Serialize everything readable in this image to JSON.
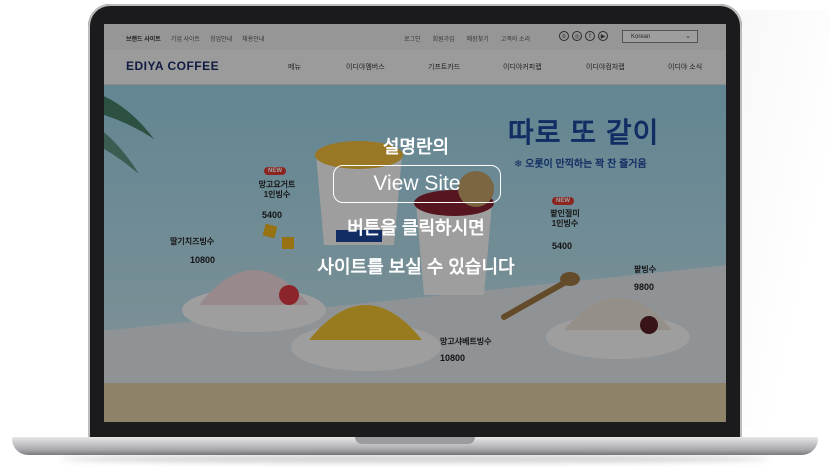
{
  "site": {
    "util_links": [
      "브랜드 사이트",
      "기업 사이트",
      "창업안내",
      "채용안내"
    ],
    "util_right": [
      "로그인",
      "회원가입",
      "매장찾기",
      "고객의 소리"
    ],
    "sns_icons": [
      "blog-icon",
      "instagram-icon",
      "facebook-icon",
      "youtube-icon"
    ],
    "language": "Korean",
    "brand": "EDIYA COFFEE",
    "nav": [
      "메뉴",
      "이디야멤버스",
      "기프트카드",
      "이디야커피랩",
      "이디야컴처랩",
      "이디야 소식"
    ]
  },
  "hero": {
    "title": "따로 또 같이",
    "subtitle": "❄ 오롯이 만끽하는 꽉 찬 즐거움",
    "products": [
      {
        "tag": "NEW",
        "name": "망고요거트\n1인빙수",
        "price": "5400"
      },
      {
        "tag": "NEW",
        "name": "팥인절미\n1인빙수",
        "price": "5400"
      },
      {
        "tag": "",
        "name": "딸기치즈빙수",
        "price": "10800"
      },
      {
        "tag": "",
        "name": "망고샤베트빙수",
        "price": "10800"
      },
      {
        "tag": "",
        "name": "팥빙수",
        "price": "9800"
      }
    ]
  },
  "overlay": {
    "line1": "설명란의",
    "button": "View Site",
    "line2": "버튼을 클릭하시면",
    "line3": "사이트를 보실 수 있습니다"
  },
  "colors": {
    "brand": "#1b2d6b",
    "accent_red": "#e23b32",
    "title_blue": "#1d4aa0",
    "sky": "#9fd8ec"
  }
}
